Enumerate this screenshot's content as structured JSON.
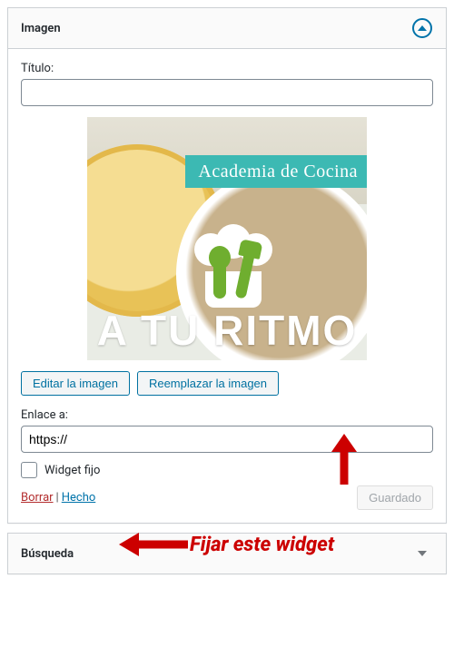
{
  "widget1": {
    "title": "Imagen",
    "fields": {
      "title_label": "Título:",
      "title_value": "",
      "link_label": "Enlace a:",
      "link_value": "https://"
    },
    "buttons": {
      "edit": "Editar la imagen",
      "replace": "Reemplazar la imagen",
      "saved": "Guardado"
    },
    "checkbox_label": "Widget fijo",
    "footer": {
      "delete": "Borrar",
      "done": "Hecho"
    },
    "image": {
      "banner_text": "Academia de Cocina",
      "caption": "A TU RITMO"
    }
  },
  "widget2": {
    "title": "Búsqueda"
  },
  "annotation": {
    "text": "Fijar este widget"
  }
}
